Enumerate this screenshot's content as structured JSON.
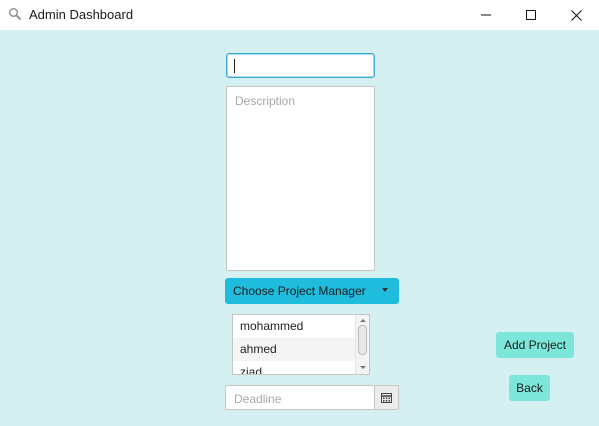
{
  "window": {
    "title": "Admin Dashboard",
    "icon": "magnifier-icon",
    "controls": [
      "minimize-icon",
      "maximize-icon",
      "close-icon"
    ]
  },
  "form": {
    "name_input": {
      "value": "",
      "placeholder": ""
    },
    "description": {
      "value": "",
      "placeholder": "Description"
    },
    "project_manager": {
      "label": "Choose Project Manager",
      "options": [
        "mohammed",
        "ahmed",
        "ziad"
      ]
    },
    "deadline": {
      "value": "",
      "placeholder": "Deadline",
      "icon": "calendar-icon"
    }
  },
  "actions": {
    "add_label": "Add Project",
    "back_label": "Back"
  },
  "colors": {
    "background": "#d4f0f1",
    "dropdown": "#1fbcde",
    "button": "#7de6da",
    "focus_border": "#3ea8d6"
  }
}
